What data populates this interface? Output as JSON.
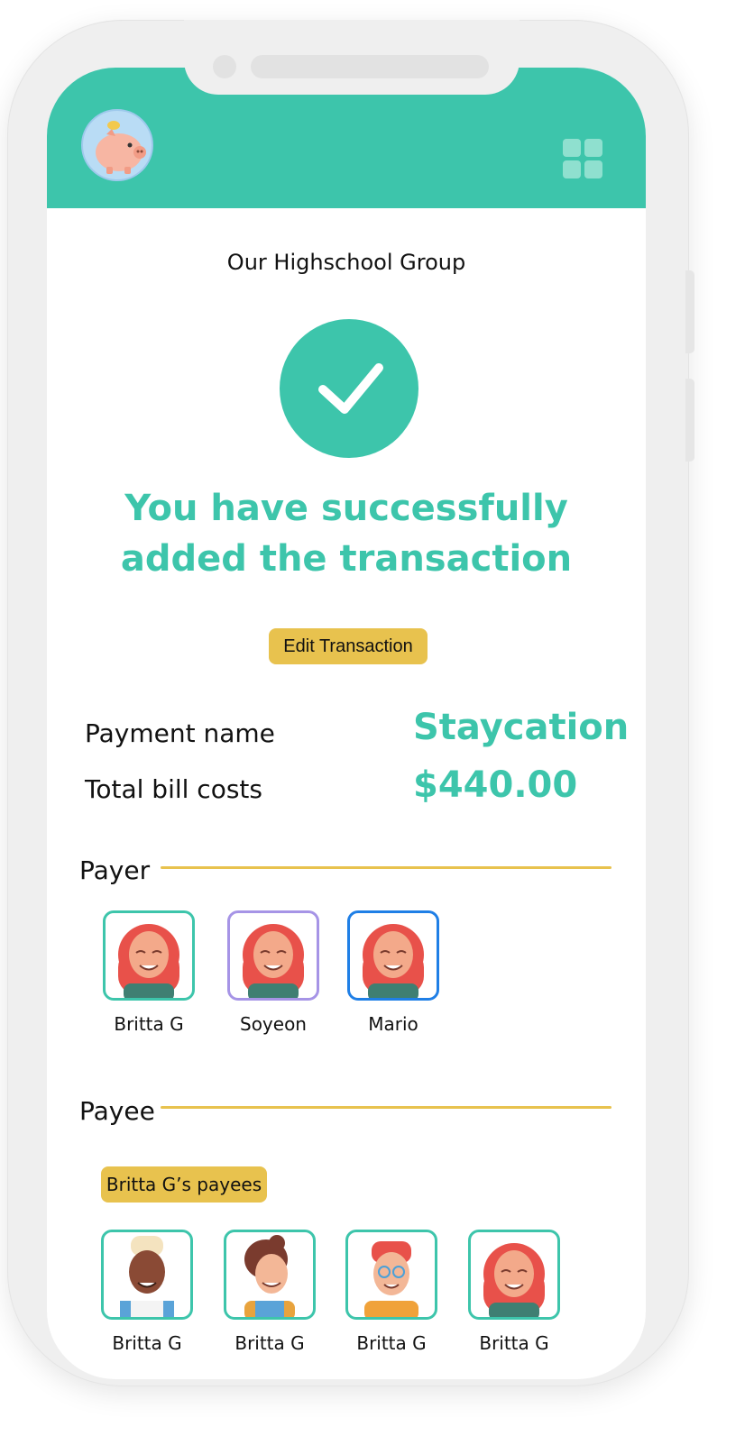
{
  "group": {
    "title": "Our Highschool Group"
  },
  "status": {
    "line1": "You have successfully",
    "line2": "added the transaction"
  },
  "actions": {
    "edit_label": "Edit Transaction"
  },
  "details": {
    "payment_name_label": "Payment name",
    "payment_name_value": "Staycation",
    "total_label": "Total bill costs",
    "total_value": "$440.00"
  },
  "payer": {
    "title": "Payer",
    "people": [
      {
        "name": "Britta G",
        "border": "#3dc5ab"
      },
      {
        "name": "Soyeon",
        "border": "#a694e6"
      },
      {
        "name": "Mario",
        "border": "#1f7fe6"
      }
    ]
  },
  "payee": {
    "title": "Payee",
    "tag": "Britta G’s payees",
    "people": [
      {
        "name": "Britta G"
      },
      {
        "name": "Britta G"
      },
      {
        "name": "Britta G"
      },
      {
        "name": "Britta G"
      }
    ]
  },
  "colors": {
    "accent": "#3dc5ab",
    "highlight": "#e8c24e"
  },
  "icons": {
    "logo": "piggy-bank-icon",
    "menu": "grid-menu-icon",
    "success": "checkmark-icon"
  }
}
